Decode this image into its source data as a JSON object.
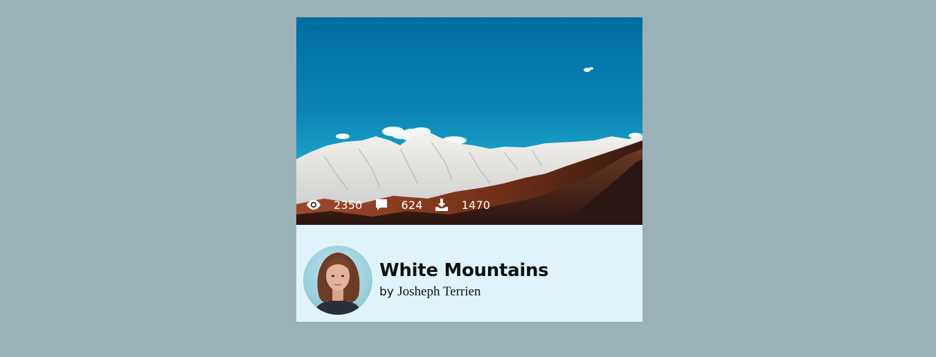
{
  "card": {
    "title": "White Mountains",
    "byline_prefix": "by",
    "author": "Josheph Terrien",
    "photo_subject": "snow-capped mountain range under blue sky",
    "stats": {
      "views": "2350",
      "comments": "624",
      "downloads": "1470"
    }
  },
  "colors": {
    "page_background": "#9ab1b7",
    "info_background": "#e0f3fb",
    "stat_text": "#ffffff",
    "title_text": "#111111"
  }
}
